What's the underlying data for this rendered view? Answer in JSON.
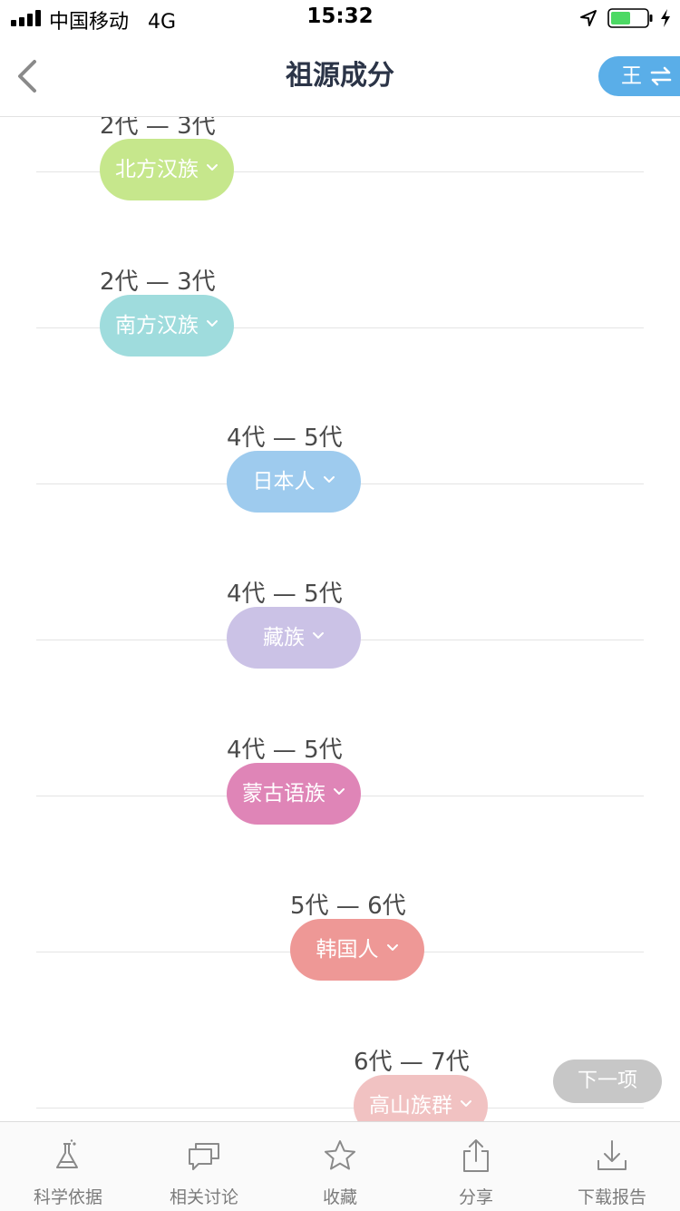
{
  "status_bar": {
    "carrier": "中国移动",
    "network": "4G",
    "time": "15:32",
    "battery_level": 0.55,
    "icons": [
      "signal-icon",
      "location-arrow-icon",
      "battery-icon",
      "charging-icon"
    ]
  },
  "nav": {
    "title": "祖源成分",
    "back_icon": "chevron-left-icon",
    "profile_name": "王",
    "swap_icon": "swap-arrows-icon"
  },
  "timeline": [
    {
      "generations": "2代 — 3代",
      "population": "北方汉族",
      "color": "#c6e78c"
    },
    {
      "generations": "2代 — 3代",
      "population": "南方汉族",
      "color": "#9fdcdd"
    },
    {
      "generations": "4代 — 5代",
      "population": "日本人",
      "color": "#9ecbee"
    },
    {
      "generations": "4代 — 5代",
      "population": "藏族",
      "color": "#cbc2e6"
    },
    {
      "generations": "4代 — 5代",
      "population": "蒙古语族",
      "color": "#df85b7"
    },
    {
      "generations": "5代 — 6代",
      "population": "韩国人",
      "color": "#ee9896"
    },
    {
      "generations": "6代 — 7代",
      "population": "高山族群",
      "color": "#f1c2c2"
    }
  ],
  "next_button": {
    "label": "下一项"
  },
  "tabs": [
    {
      "label": "科学依据",
      "icon": "flask-icon"
    },
    {
      "label": "相关讨论",
      "icon": "chat-bubbles-icon"
    },
    {
      "label": "收藏",
      "icon": "star-icon"
    },
    {
      "label": "分享",
      "icon": "share-icon"
    },
    {
      "label": "下载报告",
      "icon": "download-icon"
    }
  ]
}
